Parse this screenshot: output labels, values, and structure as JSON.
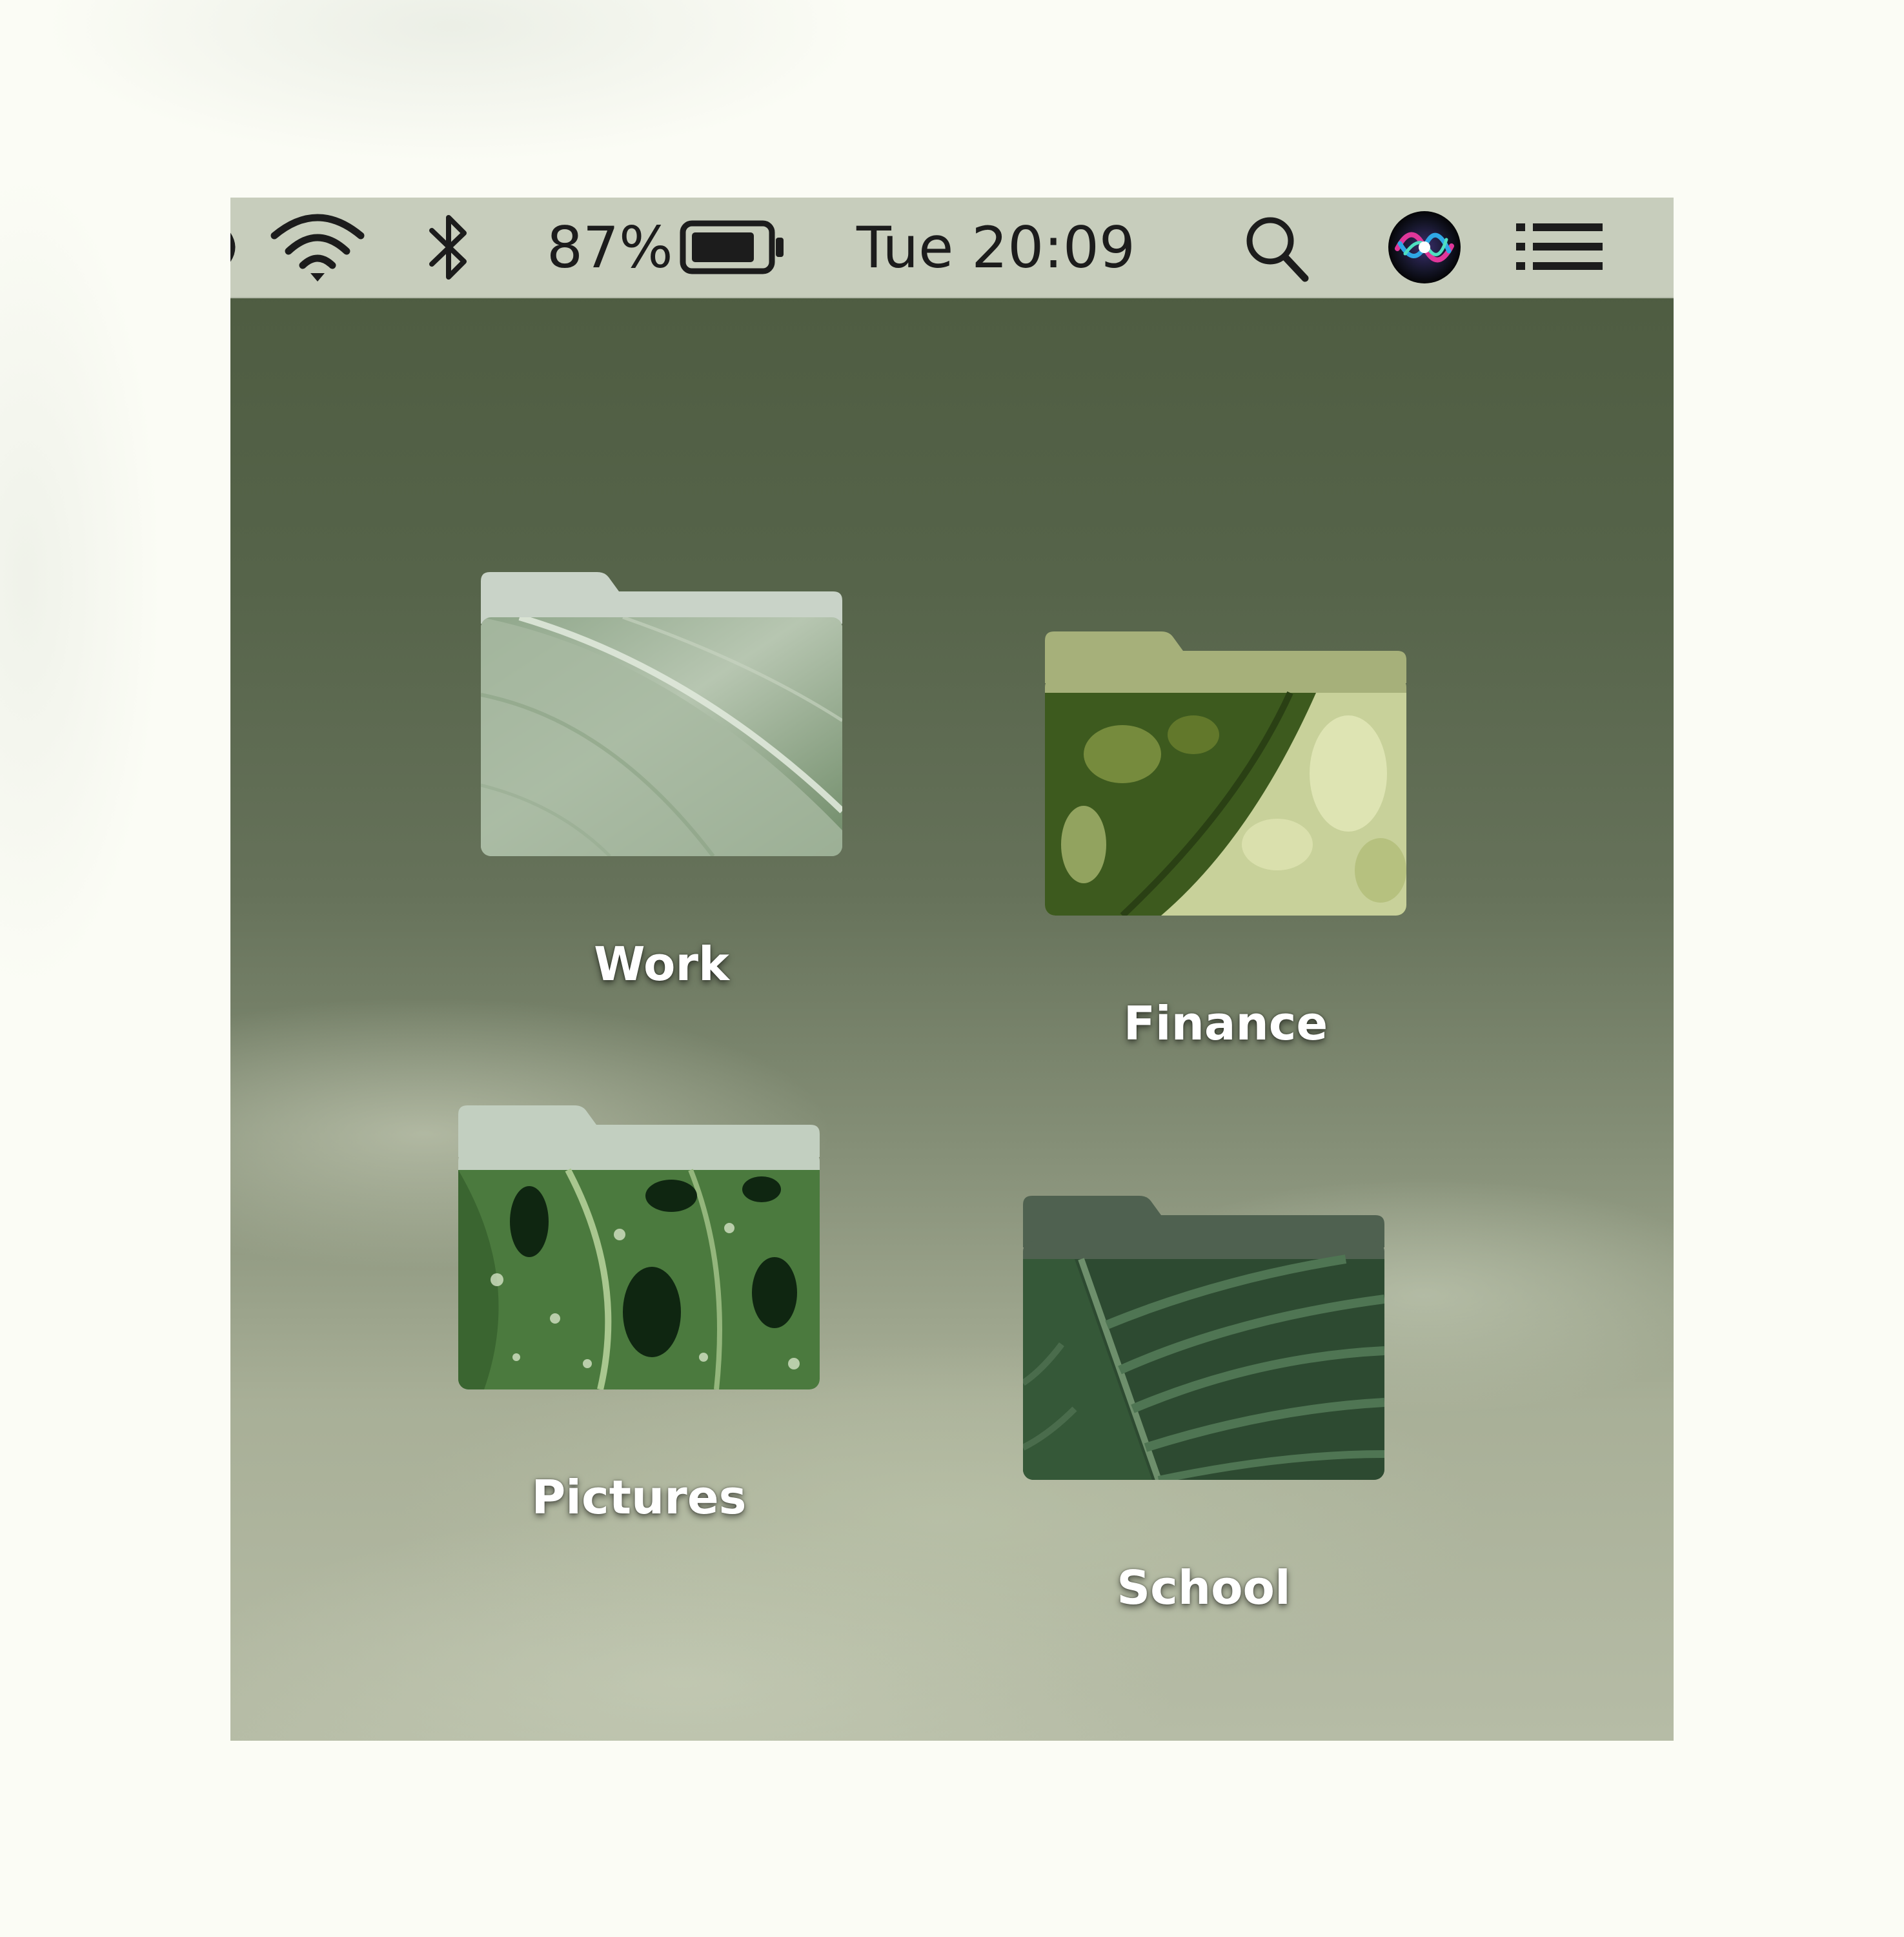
{
  "menubar": {
    "battery_percent": "87%",
    "battery_level": 0.87,
    "clock": "Tue 20:09",
    "icons": [
      "volume-icon",
      "wifi-icon",
      "bluetooth-icon",
      "battery-icon",
      "search-icon",
      "siri-icon",
      "notification-center-icon"
    ]
  },
  "desktop": {
    "folders": [
      {
        "label": "Work",
        "color": "#c9d3c8"
      },
      {
        "label": "Finance",
        "color": "#a6b07a"
      },
      {
        "label": "Pictures",
        "color": "#c2cfc0"
      },
      {
        "label": "School",
        "color": "#4f6150"
      }
    ]
  }
}
